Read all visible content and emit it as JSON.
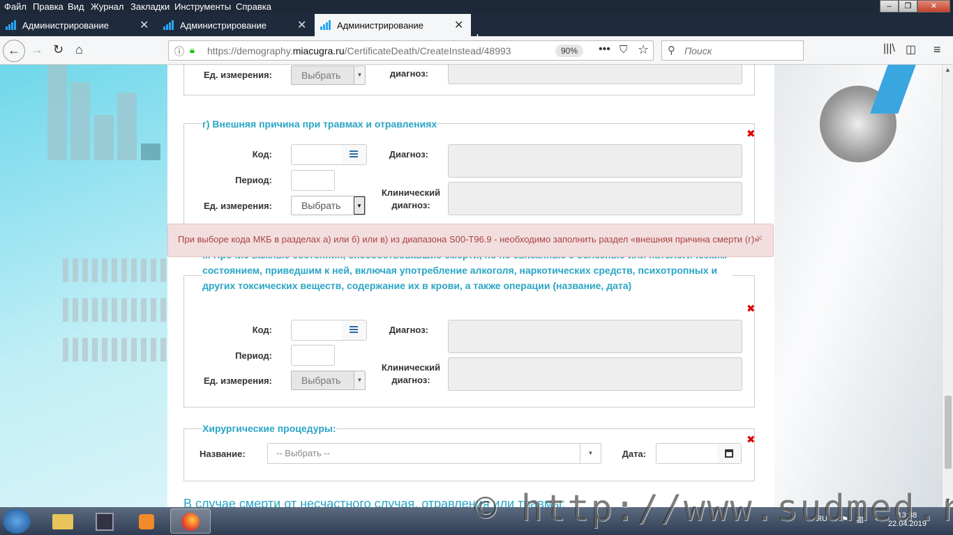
{
  "menu": {
    "items": [
      "Файл",
      "Правка",
      "Вид",
      "Журнал",
      "Закладки",
      "Инструменты",
      "Справка"
    ]
  },
  "window": {
    "minimize": "–",
    "restore": "❐",
    "close": "✕"
  },
  "tabs": [
    {
      "label": "Администрирование"
    },
    {
      "label": "Администрирование"
    },
    {
      "label": "Администрирование",
      "active": true
    }
  ],
  "nav": {
    "url_prefix": "https://demography.",
    "url_domain": "miacugra.ru",
    "url_path": "/CertificateDeath/CreateInstead/48993",
    "zoom": "90%",
    "search_placeholder": "Поиск"
  },
  "form": {
    "top": {
      "units_label": "Ед. измерения:",
      "units_value": "Выбрать",
      "diag_label": "диагноз:"
    },
    "sect_g": {
      "legend": "г) Внешняя причина при травмах и отравлениях",
      "code_label": "Код:",
      "period_label": "Период:",
      "units_label": "Ед. измерения:",
      "units_value": "Выбрать",
      "diag_label": "Диагноз:",
      "clin_diag_label": "Клинический диагноз:"
    },
    "sect_ii": {
      "legend": "II. Прочие важные состояния, способствовавшие смерти, но не связанные с болезнью или патологическим состоянием, приведшим к ней, включая употребление алкоголя, наркотических средств, психотропных и других токсических веществ, содержание их в крови, а также операции (название, дата)",
      "code_label": "Код:",
      "period_label": "Период:",
      "units_label": "Ед. измерения:",
      "units_value": "Выбрать",
      "diag_label": "Диагноз:",
      "clin_diag_label": "Клинический диагноз:"
    },
    "surg": {
      "legend": "Хирургические процедуры:",
      "name_label": "Название:",
      "name_placeholder": "-- Выбрать --",
      "date_label": "Дата:"
    },
    "bottom_title": "В случае смерти от несчастного случая, отравления или травмы:"
  },
  "alert": {
    "message": "При выборе кода МКБ в разделах а) или б) или в) из диапазона S00-T96.9 - необходимо заполнить раздел «внешняя причина смерти (г)»",
    "close": "×"
  },
  "watermark": "© http://www.sudmed.ru",
  "tray": {
    "lang": "RU",
    "time": "13:38",
    "date": "22.04.2019"
  },
  "colors": {
    "accent": "#2aa5c5",
    "alert_bg": "#f2dede",
    "alert_text": "#a94442"
  }
}
